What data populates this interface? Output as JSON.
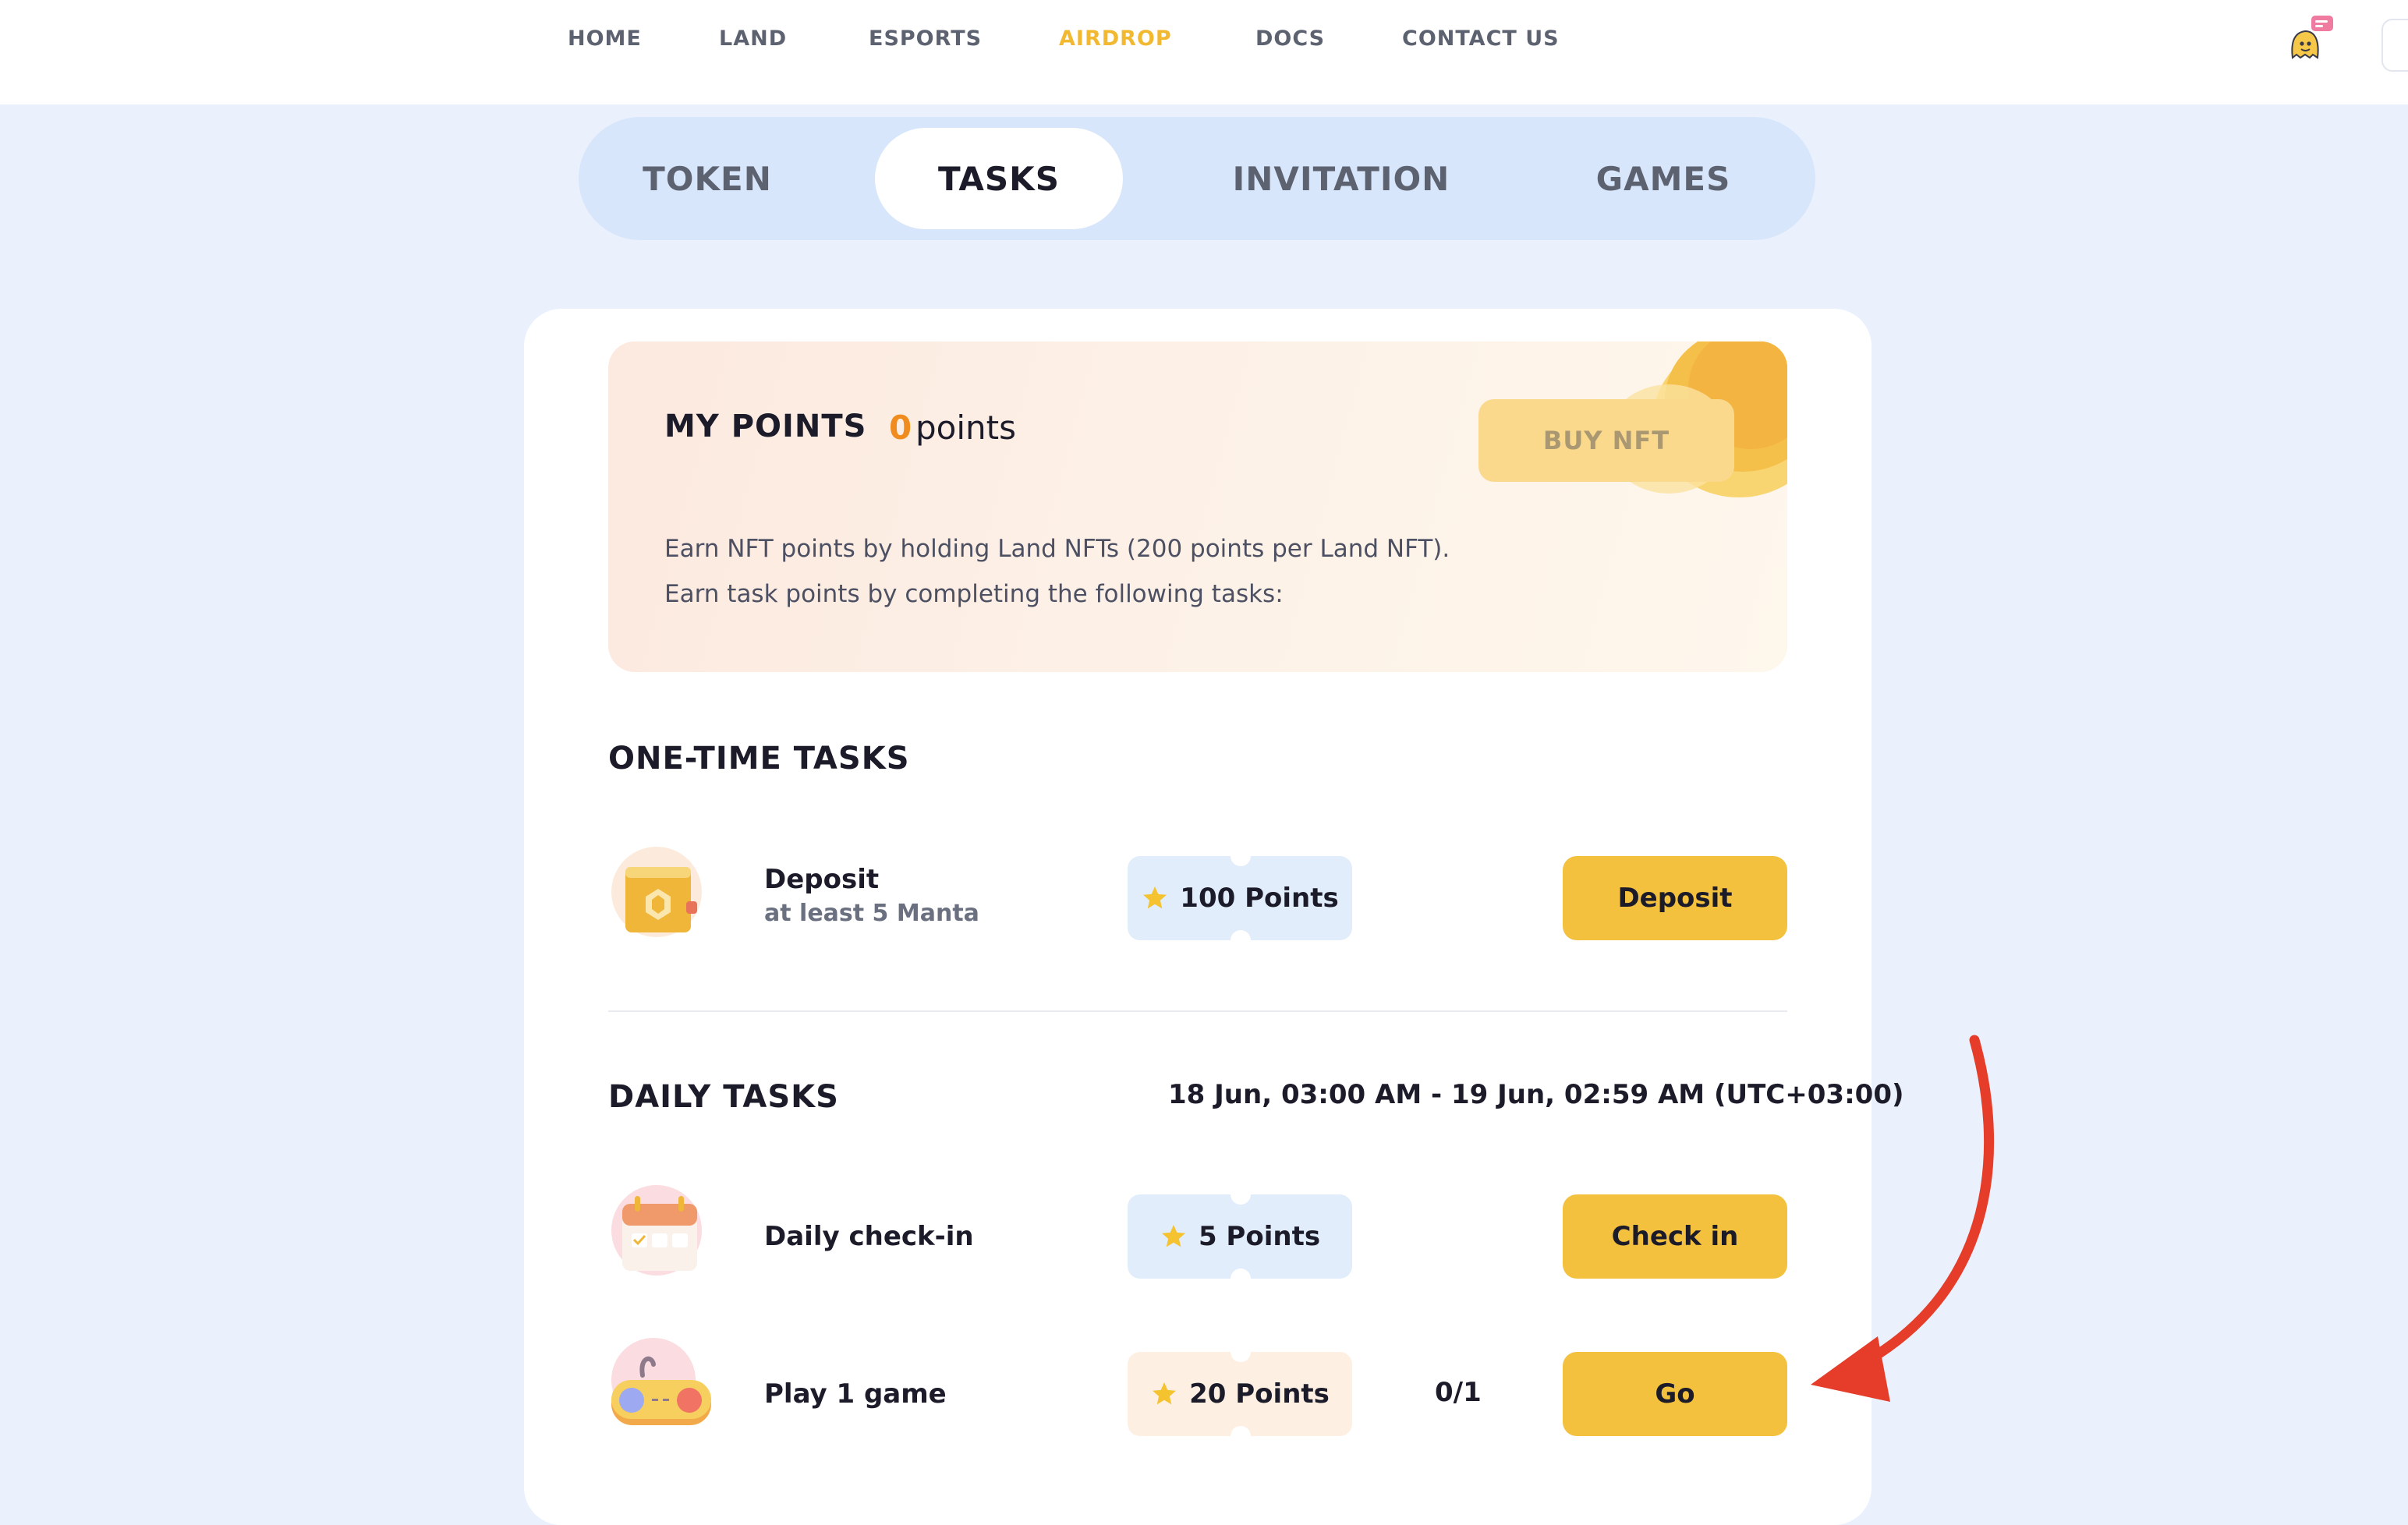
{
  "nav": {
    "items": [
      {
        "label": "HOME"
      },
      {
        "label": "LAND"
      },
      {
        "label": "ESPORTS"
      },
      {
        "label": "AIRDROP",
        "active": true
      },
      {
        "label": "DOCS"
      },
      {
        "label": "CONTACT US"
      }
    ],
    "icons": [
      "ghost-notification-icon"
    ]
  },
  "tabs": [
    {
      "label": "TOKEN"
    },
    {
      "label": "TASKS",
      "active": true
    },
    {
      "label": "INVITATION"
    },
    {
      "label": "GAMES"
    }
  ],
  "points": {
    "title": "MY POINTS",
    "value": "0",
    "unit": "points",
    "buy_label": "BUY NFT",
    "desc1": "Earn NFT points by holding Land NFTs (200 points per Land NFT).",
    "desc2": "Earn task points by completing the following tasks:"
  },
  "one_time": {
    "title": "ONE-TIME TASKS",
    "tasks": [
      {
        "name": "Deposit",
        "sub": "at least 5 Manta",
        "points": "100 Points",
        "action": "Deposit",
        "icon": "wallet-icon"
      }
    ]
  },
  "daily": {
    "title": "DAILY TASKS",
    "range": "18 Jun, 03:00 AM - 19 Jun, 02:59 AM (UTC+03:00)",
    "tasks": [
      {
        "name": "Daily check-in",
        "points": "5 Points",
        "action": "Check in",
        "icon": "calendar-icon"
      },
      {
        "name": "Play 1 game",
        "points": "20 Points",
        "progress": "0/1",
        "action": "Go",
        "icon": "gamepad-icon"
      }
    ]
  },
  "colors": {
    "accent": "#F3C13D",
    "nav_active": "#F1B830",
    "points_value": "#F08C1E",
    "arrow": "#E53D2A",
    "page_bg": "#EAF1FD"
  }
}
